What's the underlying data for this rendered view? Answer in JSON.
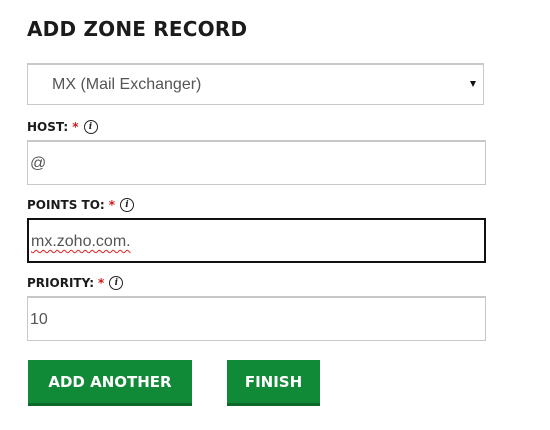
{
  "title": "ADD ZONE RECORD",
  "record_type": {
    "selected": "MX (Mail Exchanger)"
  },
  "fields": {
    "host": {
      "label": "HOST:",
      "required_mark": "*",
      "info_glyph": "i",
      "value": "@"
    },
    "points_to": {
      "label": "POINTS TO:",
      "required_mark": "*",
      "info_glyph": "i",
      "value": "mx.zoho.com."
    },
    "priority": {
      "label": "PRIORITY:",
      "required_mark": "*",
      "info_glyph": "i",
      "value": "10"
    }
  },
  "buttons": {
    "add_another": "ADD ANOTHER",
    "finish": "FINISH"
  },
  "colors": {
    "accent_green": "#108a36",
    "required_red": "#d11a1a"
  },
  "icons": {
    "info": "info-icon",
    "dropdown": "chevron-down-icon"
  }
}
